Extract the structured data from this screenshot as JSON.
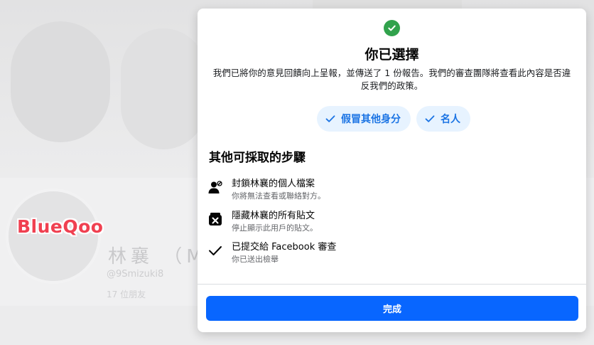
{
  "background": {
    "profile_name": "林襄 （M",
    "profile_handle": "@9Smizuki8",
    "friends": "17 位朋友"
  },
  "watermark": "BlueQoo",
  "modal": {
    "title": "你已選擇",
    "description": "我們已將你的意見回饋向上呈報，並傳送了 1 份報告。我們的審查團隊將查看此內容是否違反我們的政策。",
    "chips": [
      "假冒其他身分",
      "名人"
    ],
    "section_title": "其他可採取的步驟",
    "steps": [
      {
        "label": "封鎖林襄的個人檔案",
        "sub": "你將無法查看或聯絡對方。",
        "icon": "block-user-icon"
      },
      {
        "label": "隱藏林襄的所有貼文",
        "sub": "停止顯示此用戶的貼文。",
        "icon": "hide-posts-icon"
      },
      {
        "label": "已提交給 Facebook 審查",
        "sub": "你已送出檢舉",
        "icon": "check-icon"
      }
    ],
    "done_label": "完成"
  },
  "colors": {
    "success_green": "#31a24c",
    "primary_blue": "#0866ff",
    "chip_bg": "#e7f3ff",
    "chip_text": "#1b74e4",
    "watermark_red": "#f04050"
  }
}
